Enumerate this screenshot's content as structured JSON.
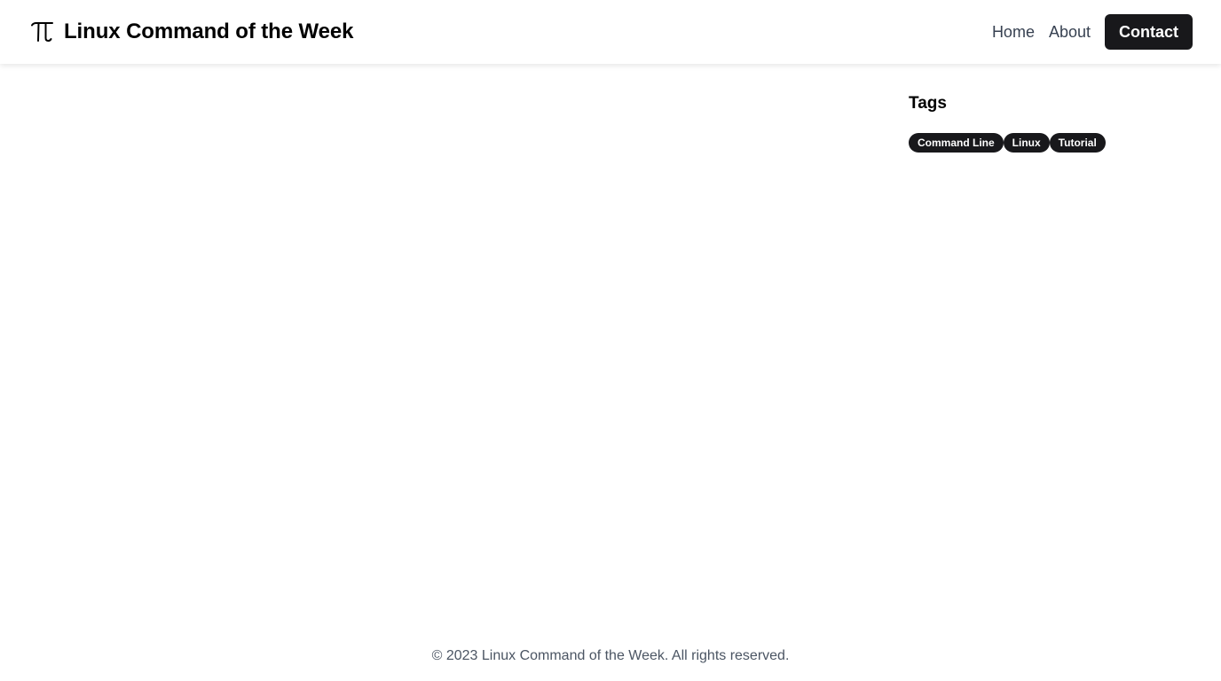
{
  "header": {
    "title": "Linux Command of the Week",
    "logo_icon": "pi-icon",
    "nav": {
      "home": "Home",
      "about": "About",
      "contact": "Contact"
    }
  },
  "sidebar": {
    "heading": "Tags",
    "tags": [
      "Command Line",
      "Linux",
      "Tutorial"
    ]
  },
  "footer": {
    "copyright": "© 2023 Linux Command of the Week. All rights reserved."
  },
  "colors": {
    "tag_background": "#18181b",
    "button_background": "#18181b",
    "text_primary": "#000000",
    "nav_text": "#374151",
    "footer_text": "#4b5563"
  }
}
